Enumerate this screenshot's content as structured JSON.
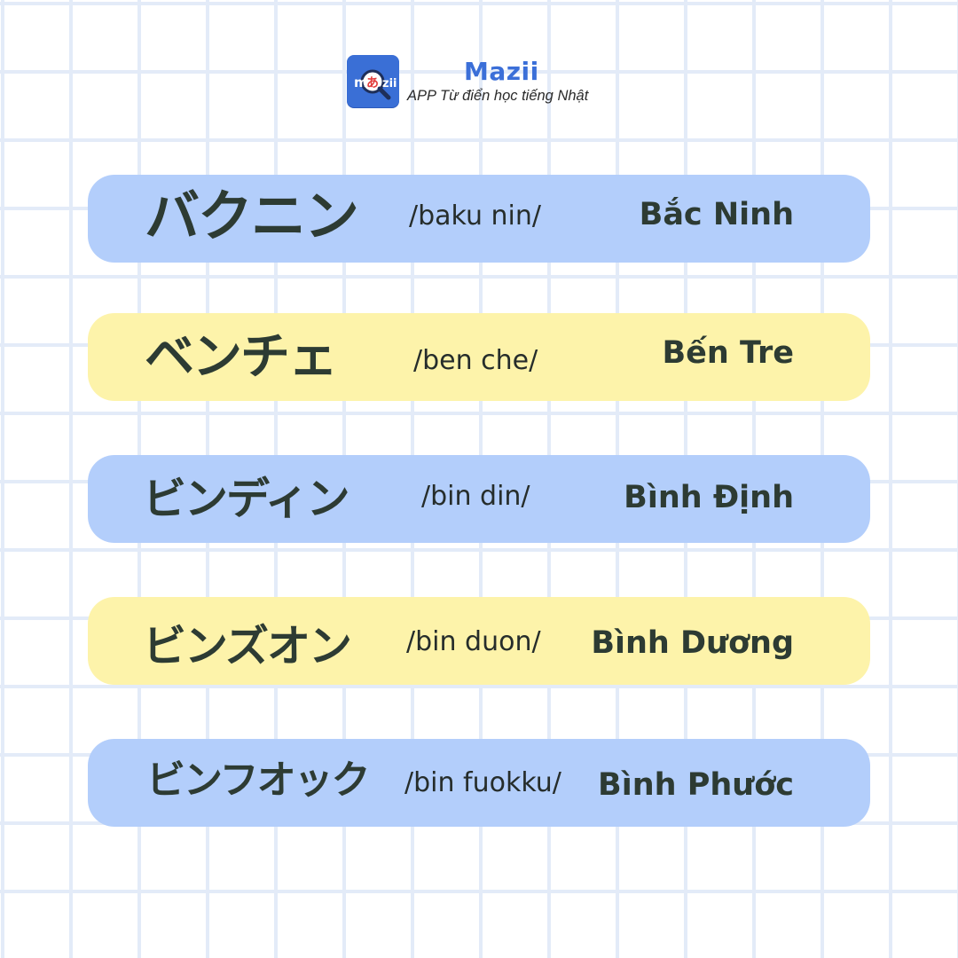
{
  "app": {
    "brand": "Mazii",
    "tagline": "APP Từ điển học tiếng Nhật",
    "logo_icon": "mazii-magnifier-logo-icon",
    "logo_text": "mあzii",
    "colors": {
      "brand_blue": "#3b6fd8",
      "row_blue": "#b3cefb",
      "row_yellow": "#fdf3aa",
      "text_dark": "#2d3b33"
    }
  },
  "entries": [
    {
      "katakana": "バクニン",
      "romaji": "/baku nin/",
      "vietnamese": "Bắc Ninh",
      "color": "blue"
    },
    {
      "katakana": "ベンチェ",
      "romaji": "/ben che/",
      "vietnamese": "Bến Tre",
      "color": "yellow"
    },
    {
      "katakana": "ビンディン",
      "romaji": "/bin din/",
      "vietnamese": "Bình Định",
      "color": "blue"
    },
    {
      "katakana": "ビンズオン",
      "romaji": "/bin duon/",
      "vietnamese": "Bình Dương",
      "color": "yellow"
    },
    {
      "katakana": "ビンフオック",
      "romaji": "/bin fuokku/",
      "vietnamese": "Bình Phước",
      "color": "blue"
    }
  ]
}
